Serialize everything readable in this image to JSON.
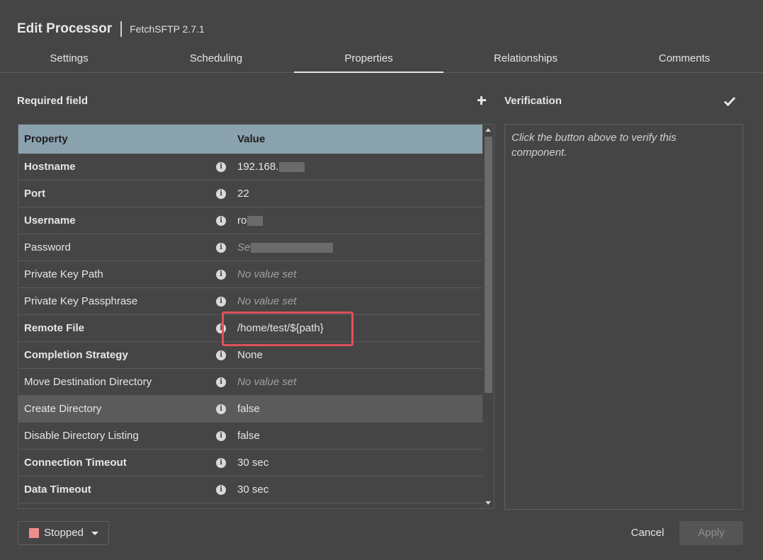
{
  "header": {
    "title": "Edit Processor",
    "subtitle": "FetchSFTP 2.7.1"
  },
  "tabs": [
    {
      "label": "Settings"
    },
    {
      "label": "Scheduling"
    },
    {
      "label": "Properties",
      "active": true
    },
    {
      "label": "Relationships"
    },
    {
      "label": "Comments"
    }
  ],
  "properties_panel": {
    "required_label": "Required field",
    "add_icon": "plus-icon",
    "columns": {
      "property": "Property",
      "value": "Value"
    },
    "rows": [
      {
        "name": "Hostname",
        "required": true,
        "value": "192.168.",
        "value_redacted": true
      },
      {
        "name": "Port",
        "required": true,
        "value": "22"
      },
      {
        "name": "Username",
        "required": true,
        "value": "ro",
        "value_redacted": true
      },
      {
        "name": "Password",
        "required": false,
        "value": "Se",
        "value_redacted": true,
        "value_empty_style": true
      },
      {
        "name": "Private Key Path",
        "required": false,
        "value": "No value set",
        "value_empty_style": true
      },
      {
        "name": "Private Key Passphrase",
        "required": false,
        "value": "No value set",
        "value_empty_style": true
      },
      {
        "name": "Remote File",
        "required": true,
        "value": "/home/test/${path}",
        "annotated": true
      },
      {
        "name": "Completion Strategy",
        "required": true,
        "value": "None"
      },
      {
        "name": "Move Destination Directory",
        "required": false,
        "value": "No value set",
        "value_empty_style": true
      },
      {
        "name": "Create Directory",
        "required": false,
        "value": "false",
        "highlighted": true
      },
      {
        "name": "Disable Directory Listing",
        "required": false,
        "value": "false"
      },
      {
        "name": "Connection Timeout",
        "required": true,
        "value": "30 sec"
      },
      {
        "name": "Data Timeout",
        "required": true,
        "value": "30 sec"
      }
    ],
    "info_icon": "info-icon",
    "annotation_color": "#e0505c"
  },
  "verification": {
    "label": "Verification",
    "verify_icon": "checkmark-icon",
    "message": "Click the button above to verify this component."
  },
  "footer": {
    "status_label": "Stopped",
    "status_color": "#f08c8c",
    "cancel_label": "Cancel",
    "apply_label": "Apply"
  }
}
